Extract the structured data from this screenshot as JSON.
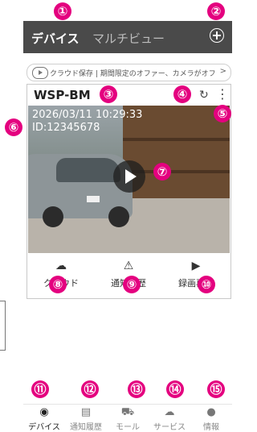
{
  "header": {
    "title": "デバイス",
    "subtitle": "マルチビュー"
  },
  "promo": {
    "text": "クラウド保存 | 期間限定のオファー、カメラがオフ",
    "chevron": ">"
  },
  "camera": {
    "name": "WSP-BM",
    "timestamp": "2026/03/11 10:29:33",
    "device_id": "ID:12345678"
  },
  "actions": [
    {
      "label": "クラウド",
      "icon": "cloud-upload-icon"
    },
    {
      "label": "通知履歴",
      "icon": "alarm-icon"
    },
    {
      "label": "録画再生",
      "icon": "video-clip-icon"
    }
  ],
  "tabs": [
    {
      "label": "デバイス",
      "icon": "device-icon",
      "active": true
    },
    {
      "label": "通知履歴",
      "icon": "message-icon",
      "active": false
    },
    {
      "label": "モール",
      "icon": "cart-icon",
      "active": false
    },
    {
      "label": "サービス",
      "icon": "cloud-icon",
      "active": false
    },
    {
      "label": "情報",
      "icon": "person-icon",
      "active": false
    }
  ],
  "callouts": [
    "①",
    "②",
    "③",
    "④",
    "⑤",
    "⑥",
    "⑦",
    "⑧",
    "⑨",
    "⑩",
    "⑪",
    "⑫",
    "⑬",
    "⑭",
    "⑮"
  ],
  "colors": {
    "callout": "#e4007f",
    "header": "#4a4a4a"
  }
}
